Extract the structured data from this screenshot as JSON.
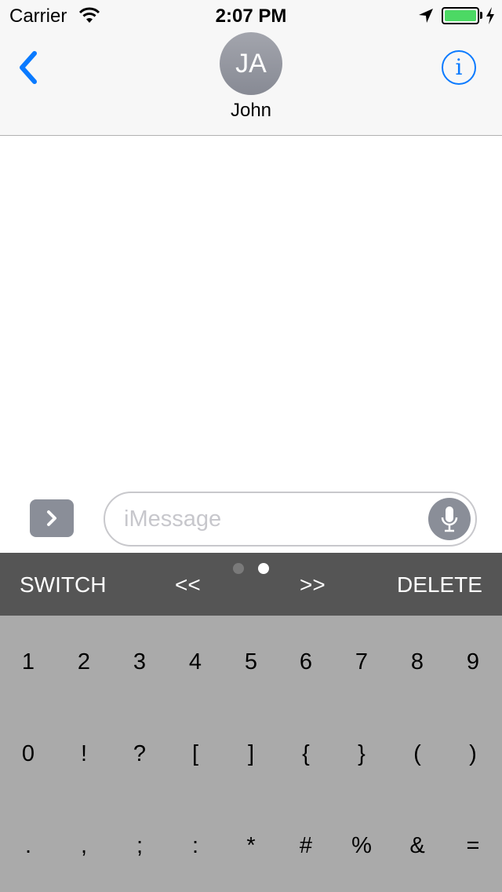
{
  "status_bar": {
    "carrier": "Carrier",
    "time": "2:07 PM",
    "battery_level": 1.0
  },
  "nav": {
    "avatar_initials": "JA",
    "contact_name": "John"
  },
  "compose": {
    "placeholder": "iMessage",
    "value": ""
  },
  "toolbar": {
    "switch_label": "SWITCH",
    "prev_label": "<<",
    "next_label": ">>",
    "delete_label": "DELETE",
    "page_count": 2,
    "active_page": 2
  },
  "keyboard": {
    "rows": [
      [
        "1",
        "2",
        "3",
        "4",
        "5",
        "6",
        "7",
        "8",
        "9"
      ],
      [
        "0",
        "!",
        "?",
        "[",
        "]",
        "{",
        "}",
        "(",
        ")"
      ],
      [
        ".",
        ",",
        ";",
        ":",
        "*",
        "#",
        "%",
        "&",
        "="
      ]
    ]
  },
  "colors": {
    "accent": "#0a7aff",
    "battery": "#4cd964",
    "toolbar_bg": "#555555",
    "keyboard_bg": "#aaaaaa",
    "avatar": "#8e9099"
  }
}
